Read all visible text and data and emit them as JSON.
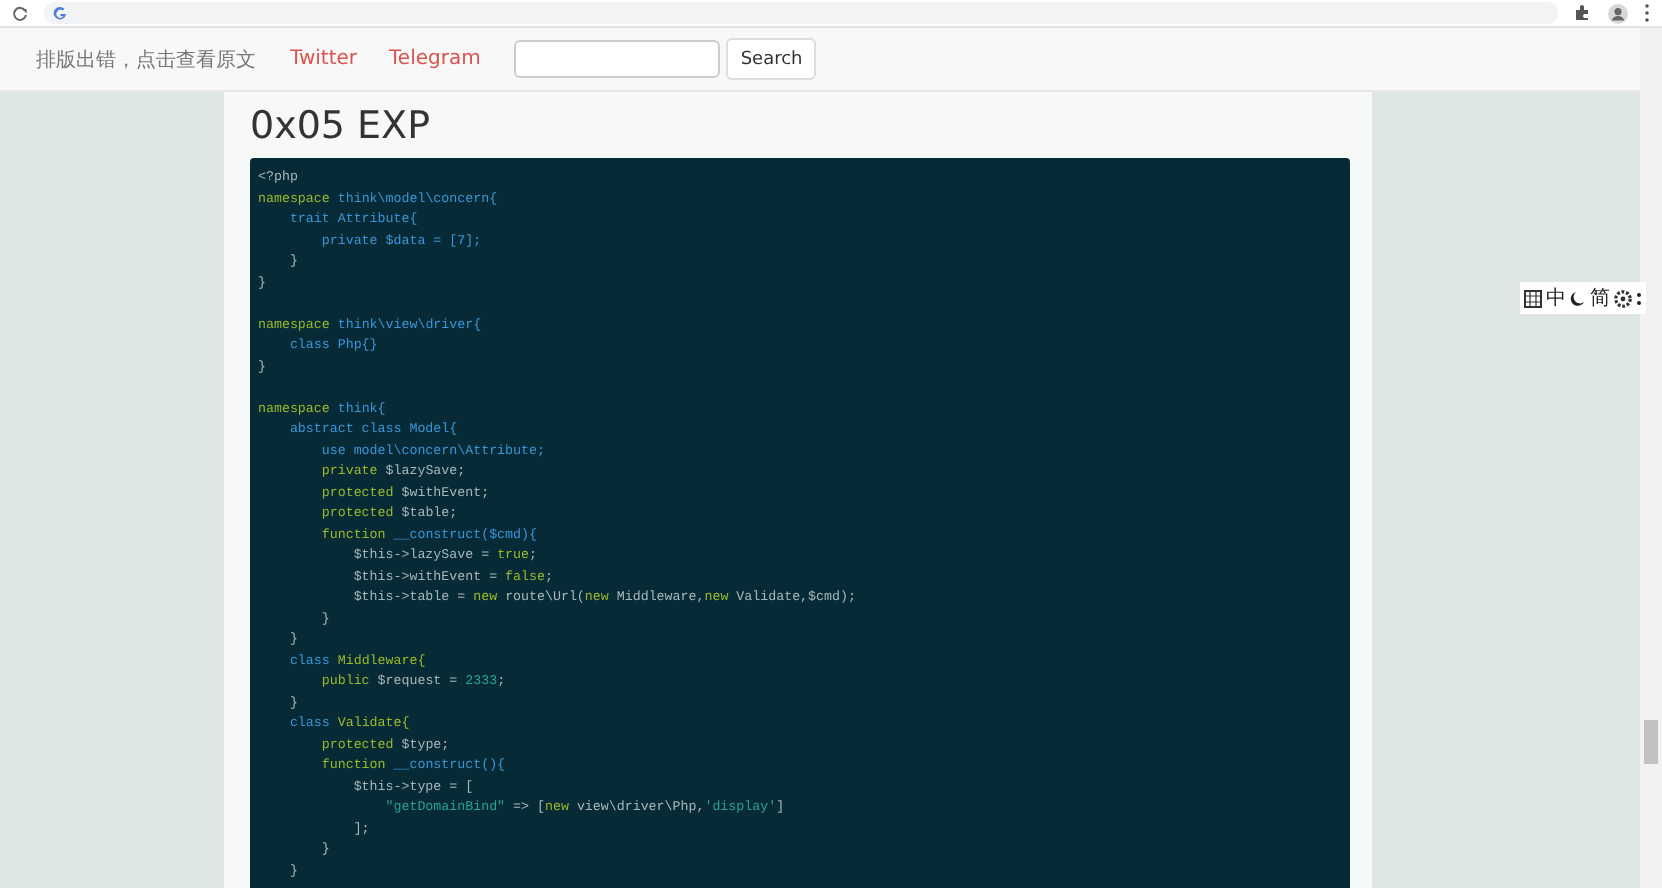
{
  "nav": {
    "notice": "排版出错，点击查看原文",
    "links": [
      "Twitter",
      "Telegram"
    ],
    "search": {
      "button": "Search"
    }
  },
  "article": {
    "heading": "0x05 EXP",
    "code": [
      {
        "kind": "code",
        "tokens": [
          {
            "kind": "plain",
            "text": "<?php"
          }
        ]
      },
      {
        "kind": "code",
        "tokens": [
          {
            "kind": "keyword",
            "text": "namespace"
          },
          {
            "kind": "name",
            "text": " think\\model\\concern{"
          }
        ]
      },
      {
        "kind": "code",
        "tokens": [
          {
            "kind": "name",
            "text": "    trait Attribute{"
          }
        ]
      },
      {
        "kind": "code",
        "tokens": [
          {
            "kind": "name",
            "text": "        private $data = [7];"
          }
        ]
      },
      {
        "kind": "code",
        "tokens": [
          {
            "kind": "plain",
            "text": "    }"
          }
        ]
      },
      {
        "kind": "code",
        "tokens": [
          {
            "kind": "plain",
            "text": "}"
          }
        ]
      },
      {
        "kind": "blank"
      },
      {
        "kind": "code",
        "tokens": [
          {
            "kind": "keyword",
            "text": "namespace"
          },
          {
            "kind": "name",
            "text": " think\\view\\driver{"
          }
        ]
      },
      {
        "kind": "code",
        "tokens": [
          {
            "kind": "name",
            "text": "    class Php{}"
          }
        ]
      },
      {
        "kind": "code",
        "tokens": [
          {
            "kind": "plain",
            "text": "}"
          }
        ]
      },
      {
        "kind": "blank"
      },
      {
        "kind": "code",
        "tokens": [
          {
            "kind": "keyword",
            "text": "namespace"
          },
          {
            "kind": "name",
            "text": " think{"
          }
        ]
      },
      {
        "kind": "code",
        "tokens": [
          {
            "kind": "name",
            "text": "    abstract class Model{"
          }
        ]
      },
      {
        "kind": "code",
        "tokens": [
          {
            "kind": "name",
            "text": "        use model\\concern\\Attribute;"
          }
        ]
      },
      {
        "kind": "code",
        "tokens": [
          {
            "kind": "keyword",
            "text": "        private"
          },
          {
            "kind": "plain",
            "text": " $lazySave;"
          }
        ]
      },
      {
        "kind": "code",
        "tokens": [
          {
            "kind": "keyword",
            "text": "        protected"
          },
          {
            "kind": "plain",
            "text": " $withEvent;"
          }
        ]
      },
      {
        "kind": "code",
        "tokens": [
          {
            "kind": "keyword",
            "text": "        protected"
          },
          {
            "kind": "plain",
            "text": " $table;"
          }
        ]
      },
      {
        "kind": "code",
        "tokens": [
          {
            "kind": "keyword",
            "text": "        function"
          },
          {
            "kind": "name",
            "text": " __construct($cmd){"
          }
        ]
      },
      {
        "kind": "code",
        "tokens": [
          {
            "kind": "plain",
            "text": "            $this->lazySave = "
          },
          {
            "kind": "keyword",
            "text": "true"
          },
          {
            "kind": "plain",
            "text": ";"
          }
        ]
      },
      {
        "kind": "code",
        "tokens": [
          {
            "kind": "plain",
            "text": "            $this->withEvent = "
          },
          {
            "kind": "keyword",
            "text": "false"
          },
          {
            "kind": "plain",
            "text": ";"
          }
        ]
      },
      {
        "kind": "code",
        "tokens": [
          {
            "kind": "plain",
            "text": "            $this->table = "
          },
          {
            "kind": "keyword",
            "text": "new"
          },
          {
            "kind": "plain",
            "text": " route\\Url("
          },
          {
            "kind": "keyword",
            "text": "new"
          },
          {
            "kind": "plain",
            "text": " Middleware,"
          },
          {
            "kind": "keyword",
            "text": "new"
          },
          {
            "kind": "plain",
            "text": " Validate,$cmd);"
          }
        ]
      },
      {
        "kind": "code",
        "tokens": [
          {
            "kind": "plain",
            "text": "        }"
          }
        ]
      },
      {
        "kind": "code",
        "tokens": [
          {
            "kind": "plain",
            "text": "    }"
          }
        ]
      },
      {
        "kind": "code",
        "tokens": [
          {
            "kind": "name",
            "text": "    class"
          },
          {
            "kind": "keyword",
            "text": " Middleware{"
          }
        ]
      },
      {
        "kind": "code",
        "tokens": [
          {
            "kind": "keyword",
            "text": "        public"
          },
          {
            "kind": "plain",
            "text": " $request = "
          },
          {
            "kind": "number",
            "text": "2333"
          },
          {
            "kind": "plain",
            "text": ";"
          }
        ]
      },
      {
        "kind": "code",
        "tokens": [
          {
            "kind": "plain",
            "text": "    }"
          }
        ]
      },
      {
        "kind": "code",
        "tokens": [
          {
            "kind": "name",
            "text": "    class"
          },
          {
            "kind": "keyword",
            "text": " Validate{"
          }
        ]
      },
      {
        "kind": "code",
        "tokens": [
          {
            "kind": "keyword",
            "text": "        protected"
          },
          {
            "kind": "plain",
            "text": " $type;"
          }
        ]
      },
      {
        "kind": "code",
        "tokens": [
          {
            "kind": "keyword",
            "text": "        function"
          },
          {
            "kind": "name",
            "text": " __construct(){"
          }
        ]
      },
      {
        "kind": "code",
        "tokens": [
          {
            "kind": "plain",
            "text": "            $this->type = ["
          }
        ]
      },
      {
        "kind": "code",
        "tokens": [
          {
            "kind": "string",
            "text": "                \"getDomainBind\""
          },
          {
            "kind": "plain",
            "text": " => ["
          },
          {
            "kind": "keyword",
            "text": "new"
          },
          {
            "kind": "plain",
            "text": " view\\driver\\Php,"
          },
          {
            "kind": "string",
            "text": "'display'"
          },
          {
            "kind": "plain",
            "text": "]"
          }
        ]
      },
      {
        "kind": "code",
        "tokens": [
          {
            "kind": "plain",
            "text": "            ];"
          }
        ]
      },
      {
        "kind": "code",
        "tokens": [
          {
            "kind": "plain",
            "text": "        }"
          }
        ]
      },
      {
        "kind": "code",
        "tokens": [
          {
            "kind": "plain",
            "text": "    }"
          }
        ]
      }
    ]
  },
  "ime_toolbar": {
    "labels": [
      "中",
      "简"
    ]
  }
}
